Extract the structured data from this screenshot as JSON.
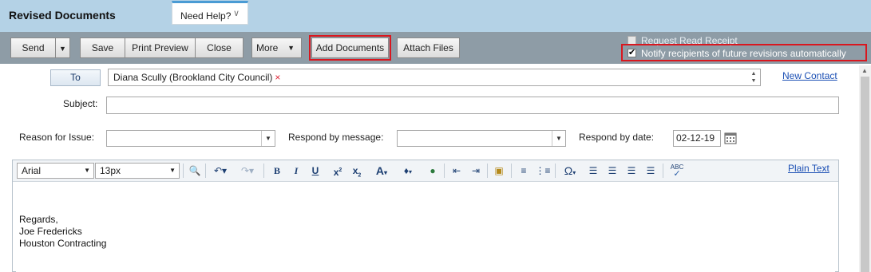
{
  "window": {
    "title": "Revised Documents"
  },
  "help_tab": {
    "label": "Need Help?",
    "icon": "chevron-down-icon"
  },
  "toolbar": {
    "send": "Send",
    "save": "Save",
    "print_preview": "Print Preview",
    "close": "Close",
    "more": "More",
    "add_documents": "Add Documents",
    "attach_files": "Attach Files"
  },
  "options": {
    "request_read_receipt": {
      "label": "Request Read Receipt",
      "checked": false
    },
    "notify_recipients": {
      "label": "Notify recipients of future revisions automatically",
      "checked": true
    }
  },
  "form": {
    "to_label": "To",
    "recipients": [
      {
        "name": "Diana Scully (Brookland City Council)"
      }
    ],
    "new_contact": "New Contact",
    "subject_label": "Subject:",
    "subject_value": "",
    "reason_label": "Reason for Issue:",
    "reason_value": "",
    "respond_message_label": "Respond by message:",
    "respond_message_value": "",
    "respond_date_label": "Respond by date:",
    "respond_date_value": "02-12-19"
  },
  "editor": {
    "font_family": "Arial",
    "font_size": "13px",
    "plain_text_link": "Plain Text",
    "body_lines": [
      "Regards,",
      "Joe Fredericks",
      "Houston Contracting"
    ]
  },
  "colors": {
    "titlebar": "#b4d2e6",
    "toolbar": "#8e9ca6",
    "highlight": "#d9171f",
    "link": "#1b4fb4"
  }
}
